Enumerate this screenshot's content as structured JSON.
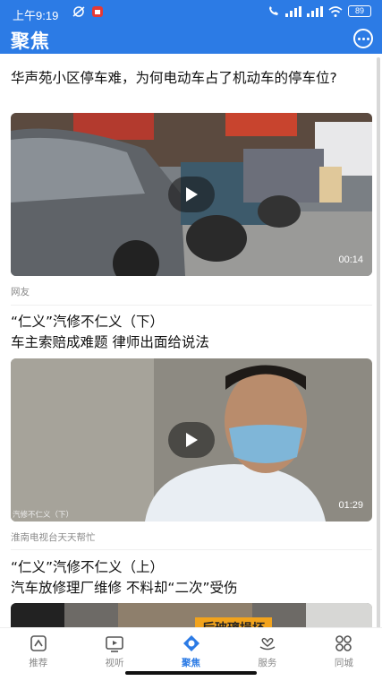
{
  "status_bar": {
    "time": "上午9:19",
    "battery": "89"
  },
  "header": {
    "title": "聚焦"
  },
  "feed": [
    {
      "title": "华声苑小区停车难，为何电动车占了机动车的停车位?",
      "duration": "00:14",
      "source": "网友"
    },
    {
      "title_line1": "“仁义”汽修不仁义（下）",
      "title_line2": "车主索赔成难题 律师出面给说法",
      "overlay_caption": "汽修不仁义（下）",
      "duration": "01:29",
      "source": "淮南电视台天天帮忙"
    },
    {
      "title_line1": "“仁义”汽修不仁义（上）",
      "title_line2": "汽车放修理厂维修 不料却“二次”受伤",
      "overlay_sign": "后玻璃损坏"
    }
  ],
  "bottom_nav": [
    {
      "label": "推荐",
      "icon": "recommend-icon"
    },
    {
      "label": "视听",
      "icon": "tv-icon"
    },
    {
      "label": "聚焦",
      "icon": "focus-icon",
      "active": true
    },
    {
      "label": "服务",
      "icon": "heart-hand-icon"
    },
    {
      "label": "同城",
      "icon": "grid-icon"
    }
  ],
  "colors": {
    "accent": "#2c7be5",
    "nav_inactive": "#888888"
  }
}
